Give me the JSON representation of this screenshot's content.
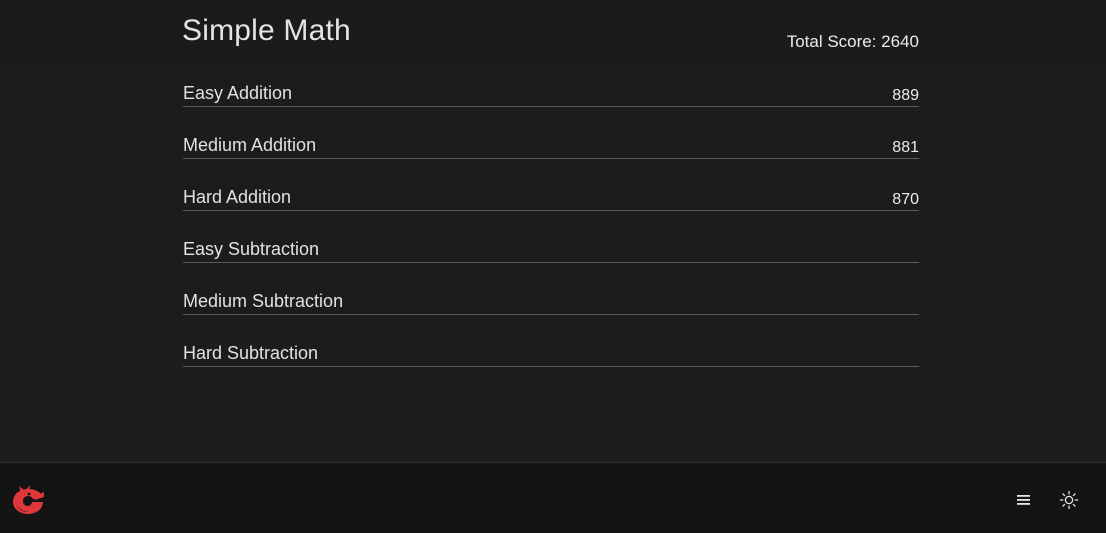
{
  "header": {
    "title": "Simple Math",
    "total_score": "Total Score: 2640"
  },
  "categories": [
    {
      "label": "Easy Addition",
      "score": "889"
    },
    {
      "label": "Medium Addition",
      "score": "881"
    },
    {
      "label": "Hard Addition",
      "score": "870"
    },
    {
      "label": "Easy Subtraction",
      "score": ""
    },
    {
      "label": "Medium Subtraction",
      "score": ""
    },
    {
      "label": "Hard Subtraction",
      "score": ""
    }
  ],
  "footer": {
    "logo_icon": "red-bird-logo-icon",
    "menu_icon": "hamburger-menu-icon",
    "theme_icon": "sun-icon"
  },
  "colors": {
    "background": "#1c1c1c",
    "footer": "#141414",
    "logo": "#e0383a",
    "text": "#e6e6e6",
    "divider": "#5a5a5a"
  }
}
